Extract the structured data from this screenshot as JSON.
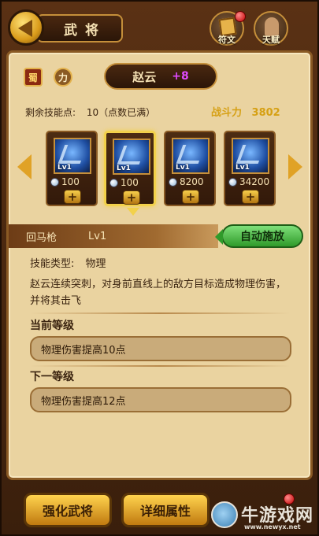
{
  "header": {
    "title": "武将",
    "tabs": [
      {
        "label": "符文",
        "icon": "rune-icon"
      },
      {
        "label": "天赋",
        "icon": "talent-icon"
      }
    ]
  },
  "hero": {
    "faction": "蜀",
    "attribute": "力",
    "name": "赵云",
    "plus": "+8",
    "skill_points_label": "剩余技能点:",
    "skill_points_value": "10（点数已满）",
    "power_label": "战斗力",
    "power_value": "3802"
  },
  "skills": [
    {
      "level": "Lv1",
      "cost": "100",
      "icon": "horse-spear-skill-icon"
    },
    {
      "level": "Lv1",
      "cost": "100",
      "icon": "spear-thrust-skill-icon"
    },
    {
      "level": "Lv1",
      "cost": "8200",
      "icon": "charge-skill-icon"
    },
    {
      "level": "Lv1",
      "cost": "34200",
      "icon": "warrior-skill-icon"
    }
  ],
  "selected_skill": {
    "name": "回马枪",
    "level": "Lv1",
    "auto_cast_label": "自动施放",
    "type_label": "技能类型:",
    "type_value": "物理",
    "description": "赵云连续突刺，对身前直线上的敌方目标造成物理伤害，并将其击飞",
    "current_level_title": "当前等级",
    "current_effect": "物理伤害提高10点",
    "next_level_title": "下一等级",
    "next_effect": "物理伤害提高12点"
  },
  "bottom": {
    "strengthen_label": "强化武将",
    "details_label": "详细属性"
  },
  "watermark": {
    "brand": "牛游戏网",
    "url": "www.newyx.net"
  },
  "colors": {
    "accent_gold": "#f2d14b",
    "panel": "#ead3a0",
    "auto_green": "#2f9a2a",
    "plus_magenta": "#e04bff",
    "power_gold": "#d6a014"
  }
}
